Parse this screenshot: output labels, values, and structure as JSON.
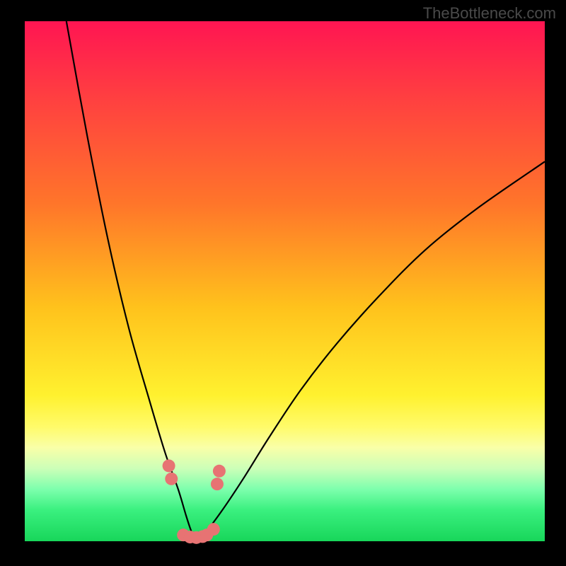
{
  "watermark": "TheBottleneck.com",
  "chart_data": {
    "type": "line",
    "title": "",
    "xlabel": "",
    "ylabel": "",
    "xlim": [
      0,
      100
    ],
    "ylim": [
      0,
      100
    ],
    "grid": false,
    "legend": false,
    "description": "Bottleneck curve plot with rainbow vertical gradient background (red=high bottleneck at top, green=low at bottom). Two black curves descend to a shared minimum near x≈33; left branch is steep, right branch rises with diminishing slope. A cluster of salmon dots sits at the valley floor.",
    "series": [
      {
        "name": "left-branch",
        "x": [
          8,
          12,
          16,
          20,
          24,
          27,
          29.5,
          31,
          32,
          33
        ],
        "y": [
          100,
          78,
          58,
          41,
          27,
          17,
          10,
          5,
          2,
          0
        ]
      },
      {
        "name": "right-branch",
        "x": [
          33,
          35,
          38,
          42,
          47,
          53,
          60,
          68,
          77,
          87,
          100
        ],
        "y": [
          0,
          2,
          6,
          12,
          20,
          29,
          38,
          47,
          56,
          64,
          73
        ]
      },
      {
        "name": "valley-dots",
        "type": "scatter",
        "x": [
          27.7,
          28.2,
          30.5,
          31.8,
          33.0,
          34.2,
          35.0,
          36.3,
          37.0,
          37.4
        ],
        "y": [
          14.5,
          12.0,
          1.2,
          0.8,
          0.7,
          0.9,
          1.2,
          2.3,
          11.0,
          13.5
        ]
      }
    ],
    "colors": {
      "curve": "#000000",
      "dots": "#e77373",
      "gradient_top": "#ff1552",
      "gradient_bottom": "#18d65a"
    }
  }
}
